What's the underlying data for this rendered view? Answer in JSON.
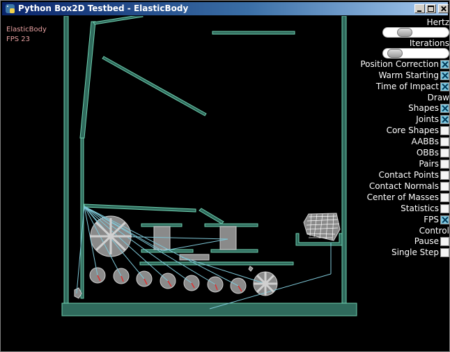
{
  "window": {
    "title": "Python Box2D Testbed - ElasticBody"
  },
  "hud": {
    "test_name": "ElasticBody",
    "fps_text": "FPS 23"
  },
  "colors": {
    "title_gradient_start": "#0a246a",
    "title_gradient_end": "#a6caf0",
    "body_outline": "#6fd0b0",
    "body_fill": "#2f6a5c",
    "dynamic_fill": "#8a8a8a",
    "joint_line": "#7fc8d8",
    "hud_text": "#e6a0a0",
    "checkbox_checked": "#7ec8e0"
  },
  "panel": {
    "hertz_label": "Hertz",
    "hertz_value_fraction": 0.3,
    "iterations_label": "Iterations",
    "iterations_value_fraction": 0.15,
    "options": [
      {
        "label": "Position Correction",
        "checked": true
      },
      {
        "label": "Warm Starting",
        "checked": true
      },
      {
        "label": "Time of Impact",
        "checked": true
      }
    ],
    "draw_label": "Draw",
    "draw_options": [
      {
        "label": "Shapes",
        "checked": true
      },
      {
        "label": "Joints",
        "checked": true
      },
      {
        "label": "Core Shapes",
        "checked": false
      },
      {
        "label": "AABBs",
        "checked": false
      },
      {
        "label": "OBBs",
        "checked": false
      },
      {
        "label": "Pairs",
        "checked": false
      },
      {
        "label": "Contact Points",
        "checked": false
      },
      {
        "label": "Contact Normals",
        "checked": false
      },
      {
        "label": "Center of Masses",
        "checked": false
      },
      {
        "label": "Statistics",
        "checked": false
      },
      {
        "label": "FPS",
        "checked": true
      }
    ],
    "control_label": "Control",
    "control_options": [
      {
        "label": "Pause",
        "checked": false
      },
      {
        "label": "Single Step",
        "checked": false
      }
    ]
  }
}
